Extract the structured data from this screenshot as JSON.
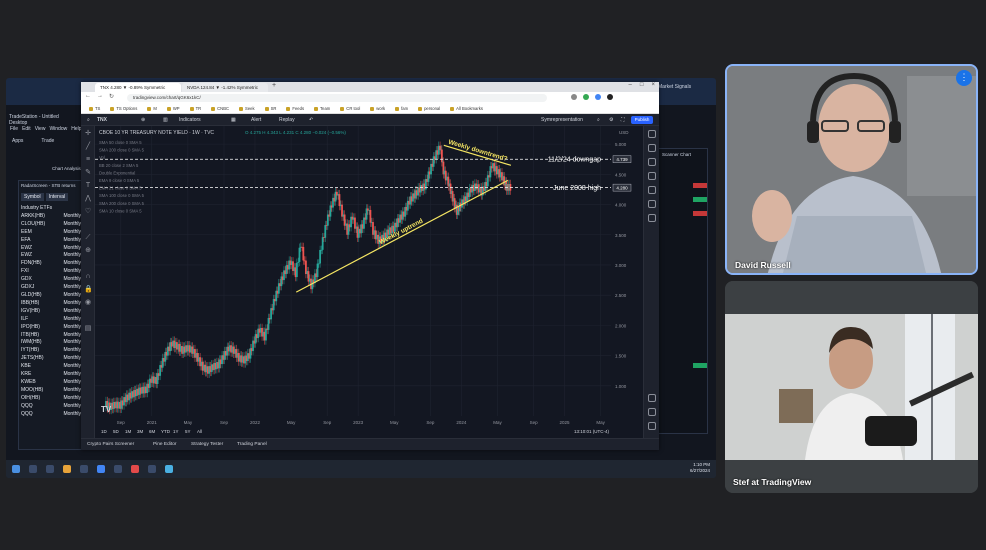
{
  "tradestation": {
    "title": "TradeStation - Untitled Desktop",
    "menu": [
      "File",
      "Edit",
      "View",
      "Window",
      "Help"
    ],
    "apps": [
      "Apps",
      "Trade"
    ],
    "chart_analysis": "Chart Analysis",
    "panel_title": "RadarScreen - STB returns",
    "panel_sub": [
      "Timeframe",
      "Studies"
    ],
    "columns": [
      "Symbol",
      "Interval"
    ],
    "list_header": "Industry ETFs",
    "symbols": [
      "ARKK(HB)",
      "CLOU(HB)",
      "EEM",
      "EFA",
      "EWZ",
      "EWZ",
      "FDN(HB)",
      "FXI",
      "GDX",
      "GDXJ",
      "GLD(HB)",
      "IBB(HB)",
      "IGV(HB)",
      "ILF",
      "IPO(HB)",
      "ITB(HB)",
      "IWM(HB)",
      "IYT(HB)",
      "JETS(HB)",
      "KBE",
      "KRE",
      "KWEB",
      "MOO(HB)",
      "OIH(HB)",
      "QQQ",
      "QQQ"
    ],
    "interval": "Monthly",
    "right_panel_title": "Scanner Chart",
    "right_labels": [
      "Market Signals"
    ],
    "clock_time": "1:10 PM",
    "clock_date": "6/27/2024"
  },
  "browser": {
    "tab1": "TNX 4.280 ▼ -0.89% Symmetric",
    "tab2": "NVDA 124.84 ▼ -1.42% Symmetric",
    "url": "tradingview.com/chart/qGK6x1kC/",
    "bookmarks": [
      "TS",
      "TS Options",
      "M",
      "WP",
      "TR",
      "CNBC",
      "Seek",
      "SR",
      "Feeds",
      "Team",
      "CR tool",
      "work",
      "fam",
      "personal",
      "All Bookmarks"
    ]
  },
  "tv": {
    "symbol": "TNX",
    "indicators_label": "Indicators",
    "alert_label": "Alert",
    "replay_label": "Replay",
    "layout_name": "Symrepresentation",
    "publish_label": "Publish",
    "legend_title": "CBOE 10 YR TREASURY NOTE YIELD · 1W · TVC",
    "legend_ohlc": "O 4.275 H 4.343 L 4.231 C 4.280 −0.024 (−0.56%)",
    "currency": "USD",
    "indicator_lines": [
      "SMA 50 close 0 SMA 5",
      "SMA 200 close 0 SMA 5",
      "Vol",
      "BB 20 close 2 SMA 5",
      "Double Exponential",
      "EMA 9 close 0 SMA 5",
      "EMA 21 close 0 SMA 5",
      "SMA 100 close 0 SMA 5",
      "SMA 200 close 0 SMA 5",
      "SMA 10 close 0 SMA 5"
    ],
    "timeframes": [
      "1D",
      "5D",
      "1M",
      "3M",
      "6M",
      "YTD",
      "1Y",
      "5Y",
      "All"
    ],
    "time_readout": "13:10:01 (UTC-4)",
    "bottom_tabs": [
      "Crypto Pairs Screener",
      "Pine Editor",
      "Strategy Tester",
      "Trading Panel"
    ]
  },
  "chart_data": {
    "type": "line",
    "title": "CBOE 10 YR TREASURY NOTE YIELD · 1W · TVC",
    "xlabel": "",
    "ylabel": "",
    "ylim": [
      0.5,
      5.3
    ],
    "xlim": [
      2020.45,
      2025.45
    ],
    "x_ticks": [
      {
        "x": 2020.7,
        "label": "Sep"
      },
      {
        "x": 2021.0,
        "label": "2021"
      },
      {
        "x": 2021.35,
        "label": "May"
      },
      {
        "x": 2021.7,
        "label": "Sep"
      },
      {
        "x": 2022.0,
        "label": "2022"
      },
      {
        "x": 2022.35,
        "label": "May"
      },
      {
        "x": 2022.7,
        "label": "Sep"
      },
      {
        "x": 2023.0,
        "label": "2023"
      },
      {
        "x": 2023.35,
        "label": "May"
      },
      {
        "x": 2023.7,
        "label": "Sep"
      },
      {
        "x": 2024.0,
        "label": "2024"
      },
      {
        "x": 2024.35,
        "label": "May"
      },
      {
        "x": 2024.7,
        "label": "Sep"
      },
      {
        "x": 2025.0,
        "label": "2025"
      },
      {
        "x": 2025.35,
        "label": "May"
      }
    ],
    "y_ticks": [
      1.0,
      1.5,
      2.0,
      2.5,
      3.0,
      3.5,
      4.0,
      4.5,
      5.0
    ],
    "series": [
      {
        "values": [
          [
            2020.55,
            0.7
          ],
          [
            2020.6,
            0.65
          ],
          [
            2020.65,
            0.68
          ],
          [
            2020.7,
            0.67
          ],
          [
            2020.75,
            0.78
          ],
          [
            2020.8,
            0.84
          ],
          [
            2020.85,
            0.88
          ],
          [
            2020.9,
            0.92
          ],
          [
            2020.95,
            0.93
          ],
          [
            2021.0,
            1.1
          ],
          [
            2021.05,
            1.08
          ],
          [
            2021.1,
            1.35
          ],
          [
            2021.15,
            1.55
          ],
          [
            2021.2,
            1.7
          ],
          [
            2021.25,
            1.65
          ],
          [
            2021.3,
            1.58
          ],
          [
            2021.35,
            1.62
          ],
          [
            2021.4,
            1.58
          ],
          [
            2021.45,
            1.45
          ],
          [
            2021.5,
            1.3
          ],
          [
            2021.55,
            1.25
          ],
          [
            2021.6,
            1.31
          ],
          [
            2021.65,
            1.34
          ],
          [
            2021.7,
            1.48
          ],
          [
            2021.75,
            1.62
          ],
          [
            2021.8,
            1.58
          ],
          [
            2021.85,
            1.45
          ],
          [
            2021.9,
            1.42
          ],
          [
            2021.95,
            1.5
          ],
          [
            2022.0,
            1.75
          ],
          [
            2022.05,
            1.93
          ],
          [
            2022.1,
            1.8
          ],
          [
            2022.15,
            2.15
          ],
          [
            2022.2,
            2.45
          ],
          [
            2022.25,
            2.7
          ],
          [
            2022.3,
            2.9
          ],
          [
            2022.35,
            3.05
          ],
          [
            2022.4,
            2.85
          ],
          [
            2022.45,
            3.35
          ],
          [
            2022.5,
            2.9
          ],
          [
            2022.55,
            2.65
          ],
          [
            2022.6,
            2.85
          ],
          [
            2022.65,
            3.3
          ],
          [
            2022.7,
            3.7
          ],
          [
            2022.75,
            4.0
          ],
          [
            2022.8,
            4.2
          ],
          [
            2022.85,
            3.85
          ],
          [
            2022.9,
            3.55
          ],
          [
            2022.95,
            3.8
          ],
          [
            2023.0,
            3.5
          ],
          [
            2023.05,
            3.65
          ],
          [
            2023.1,
            3.95
          ],
          [
            2023.15,
            3.55
          ],
          [
            2023.2,
            3.4
          ],
          [
            2023.25,
            3.45
          ],
          [
            2023.3,
            3.55
          ],
          [
            2023.35,
            3.6
          ],
          [
            2023.4,
            3.75
          ],
          [
            2023.45,
            3.85
          ],
          [
            2023.5,
            4.05
          ],
          [
            2023.55,
            4.15
          ],
          [
            2023.6,
            4.25
          ],
          [
            2023.65,
            4.3
          ],
          [
            2023.7,
            4.55
          ],
          [
            2023.75,
            4.8
          ],
          [
            2023.8,
            4.95
          ],
          [
            2023.83,
            4.55
          ],
          [
            2023.88,
            4.35
          ],
          [
            2023.92,
            4.1
          ],
          [
            2023.96,
            3.88
          ],
          [
            2024.0,
            4.0
          ],
          [
            2024.05,
            4.1
          ],
          [
            2024.1,
            4.25
          ],
          [
            2024.15,
            4.3
          ],
          [
            2024.2,
            4.2
          ],
          [
            2024.25,
            4.35
          ],
          [
            2024.3,
            4.65
          ],
          [
            2024.35,
            4.55
          ],
          [
            2024.4,
            4.45
          ],
          [
            2024.44,
            4.28
          ],
          [
            2024.48,
            4.28
          ]
        ]
      }
    ],
    "price_labels": [
      {
        "value": 4.75,
        "label": "4.739",
        "color": "#ffffff"
      },
      {
        "value": 4.28,
        "label": "4.280",
        "color": "#ffffff"
      }
    ],
    "annotations": [
      {
        "label": "11/2/24 downgap",
        "value": 4.75,
        "style": "dashed"
      },
      {
        "label": "June 2008 high",
        "value": 4.28,
        "style": "dashed"
      },
      {
        "label": "Weekly uptrend",
        "color": "#f5e663",
        "from": [
          2022.4,
          2.55
        ],
        "to": [
          2024.45,
          4.4
        ]
      },
      {
        "label": "Weekly downtrend?",
        "color": "#f5e663",
        "from": [
          2023.83,
          4.98
        ],
        "to": [
          2024.48,
          4.65
        ]
      }
    ]
  },
  "meet": {
    "presenter1": "David Russell",
    "presenter2": "Stef at TradingView",
    "more_icon": "more-vert-icon"
  },
  "colors": {
    "candle_up": "#26a69a",
    "candle_down": "#ef5350",
    "annotation": "#f5e663",
    "accent": "#2962ff",
    "active_speaker": "#8ab4f8"
  }
}
